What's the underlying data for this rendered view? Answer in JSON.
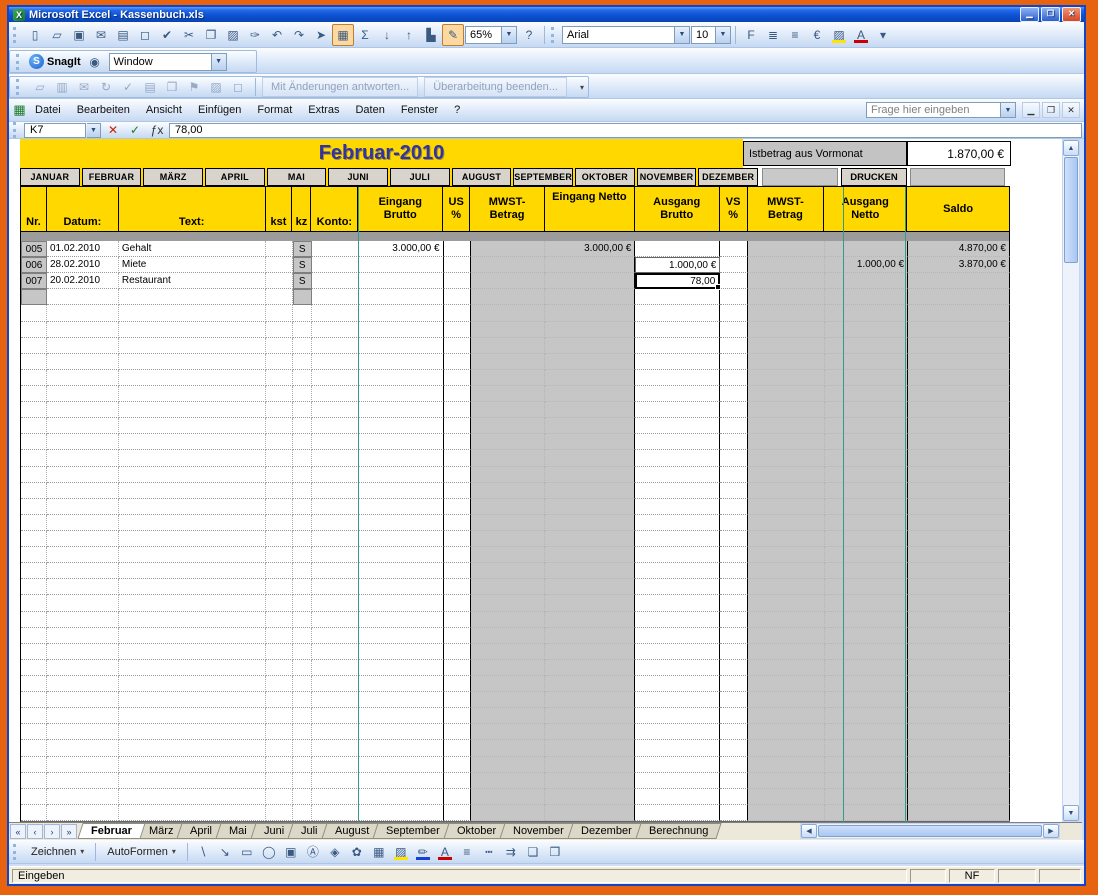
{
  "window": {
    "title": "Microsoft Excel - Kassenbuch.xls"
  },
  "window_buttons": [
    {
      "name": "minimize-button",
      "glyph": "▁"
    },
    {
      "name": "restore-button",
      "glyph": "❐"
    },
    {
      "name": "close-button",
      "glyph": "✕",
      "close": true
    }
  ],
  "standard_icons": [
    {
      "name": "new-icon",
      "glyph": "▯"
    },
    {
      "name": "open-icon",
      "glyph": "▱"
    },
    {
      "name": "save-icon",
      "glyph": "▣"
    },
    {
      "name": "mail-icon",
      "glyph": "✉"
    },
    {
      "name": "print-icon",
      "glyph": "▤"
    },
    {
      "name": "print-preview-icon",
      "glyph": "◻"
    },
    {
      "name": "spelling-icon",
      "glyph": "✔"
    },
    {
      "name": "cut-icon",
      "glyph": "✂"
    },
    {
      "name": "copy-icon",
      "glyph": "❐"
    },
    {
      "name": "paste-icon",
      "glyph": "▨"
    },
    {
      "name": "format-painter-icon",
      "glyph": "✑"
    },
    {
      "name": "undo-icon",
      "glyph": "↶"
    },
    {
      "name": "redo-icon",
      "glyph": "↷"
    },
    {
      "name": "hyperlink-icon",
      "glyph": "➤"
    },
    {
      "name": "euro-convert-icon",
      "glyph": "▦",
      "highlight": true
    },
    {
      "name": "autosum-icon",
      "glyph": "Σ"
    },
    {
      "name": "sort-ascending-icon",
      "glyph": "↓"
    },
    {
      "name": "sort-descending-icon",
      "glyph": "↑"
    },
    {
      "name": "chart-wizard-icon",
      "glyph": "▙"
    },
    {
      "name": "drawing-icon",
      "glyph": "✎",
      "highlight": true
    }
  ],
  "standard_toolbar": {
    "zoom_value": "65%"
  },
  "standard_icons_tail": [
    {
      "name": "help-icon",
      "glyph": "?"
    }
  ],
  "formatting": {
    "font_name": "Arial",
    "font_size": "10"
  },
  "formatting_icons": [
    {
      "name": "bold-icon",
      "glyph": "F"
    },
    {
      "name": "align-left-icon",
      "glyph": "≣"
    },
    {
      "name": "align-center-icon",
      "glyph": "≡"
    },
    {
      "name": "euro-style-icon",
      "glyph": "€"
    },
    {
      "name": "fill-color-icon",
      "glyph": "▨",
      "bar": "#ffe400"
    },
    {
      "name": "font-color-icon",
      "glyph": "A",
      "bar": "#cc0000"
    },
    {
      "name": "toolbar-options-icon",
      "glyph": "▾"
    }
  ],
  "snagit_toolbar": {
    "brand": "SnagIt",
    "profile": "Window"
  },
  "snagit_icons": [
    {
      "name": "capture-icon",
      "glyph": "◉"
    }
  ],
  "review_icons": [
    {
      "name": "review-tool-icon",
      "glyph": "▱",
      "disabled": true
    },
    {
      "name": "review-tool-icon",
      "glyph": "▥",
      "disabled": true
    },
    {
      "name": "review-tool-icon",
      "glyph": "✉",
      "disabled": true
    },
    {
      "name": "review-tool-icon",
      "glyph": "↻",
      "disabled": true
    },
    {
      "name": "review-tool-icon",
      "glyph": "✓",
      "disabled": true
    },
    {
      "name": "review-tool-icon",
      "glyph": "▤",
      "disabled": true
    },
    {
      "name": "review-tool-icon",
      "glyph": "❐",
      "disabled": true
    },
    {
      "name": "review-tool-icon",
      "glyph": "⚑",
      "disabled": true
    },
    {
      "name": "review-tool-icon",
      "glyph": "▨",
      "disabled": true
    },
    {
      "name": "review-tool-icon",
      "glyph": "◻",
      "disabled": true
    }
  ],
  "review_toolbar": {
    "buttons": [
      "Mit Änderungen antworten...",
      "Überarbeitung beenden..."
    ]
  },
  "menubar": {
    "items": [
      "Datei",
      "Bearbeiten",
      "Ansicht",
      "Einfügen",
      "Format",
      "Extras",
      "Daten",
      "Fenster",
      "?"
    ],
    "question_box": "Frage hier eingeben"
  },
  "workbook_window_buttons": [
    {
      "name": "minimize-window-icon",
      "glyph": "▁"
    },
    {
      "name": "restore-window-icon",
      "glyph": "❐"
    },
    {
      "name": "close-window-icon",
      "glyph": "✕"
    }
  ],
  "formula_bar": {
    "name_box": "K7",
    "input_value": "78,00"
  },
  "formula_icons": [
    {
      "name": "cancel-icon",
      "glyph": "✕",
      "color": "#cc2200"
    },
    {
      "name": "enter-icon",
      "glyph": "✓",
      "color": "#1a7a1a"
    },
    {
      "name": "insert-function-icon",
      "glyph": "ƒx",
      "color": "#333333"
    }
  ],
  "header": {
    "title": "Februar-2010",
    "carryover_label": "Istbetrag aus Vormonat",
    "carryover_value": "1.870,00 €"
  },
  "month_buttons": [
    "JANUAR",
    "FEBRUAR",
    "MÄRZ",
    "APRIL",
    "MAI",
    "JUNI",
    "JULI",
    "AUGUST",
    "SEPTEMBER",
    "OKTOBER",
    "NOVEMBER",
    "DEZEMBER"
  ],
  "print_button": "DRUCKEN",
  "table": {
    "columns": [
      "Nr.",
      "Datum:",
      "Text:",
      "kst",
      "kz",
      "Konto:",
      "Eingang\nBrutto",
      "US\n%",
      "MWST-\nBetrag",
      "Eingang Netto",
      "Ausgang\nBrutto",
      "VS\n%",
      "MWST-\nBetrag",
      "Ausgang\nNetto",
      "Saldo"
    ],
    "rows": [
      [
        "005",
        "01.02.2010",
        "Gehalt",
        "",
        "S",
        "",
        "3.000,00 €",
        "",
        "",
        "3.000,00 €",
        "",
        "",
        "",
        "",
        "4.870,00 €"
      ],
      [
        "006",
        "28.02.2010",
        "Miete",
        "",
        "S",
        "",
        "",
        "",
        "",
        "",
        "1.000,00 €",
        "",
        "",
        "1.000,00 €",
        "3.870,00 €"
      ],
      [
        "007",
        "20.02.2010",
        "Restaurant",
        "",
        "S",
        "",
        "",
        "",
        "",
        "",
        "78,00",
        "",
        "",
        "",
        ""
      ]
    ],
    "selected_cell": {
      "ref": "K7",
      "row": 2,
      "col": 10
    },
    "boxed_cell": {
      "row": 1,
      "col": 10
    }
  },
  "sheet_tabs": [
    "Februar",
    "März",
    "April",
    "Mai",
    "Juni",
    "Juli",
    "August",
    "September",
    "Oktober",
    "November",
    "Dezember",
    "Berechnung"
  ],
  "active_tab": "Februar",
  "tabnav_icons": [
    {
      "name": "first-sheet-icon",
      "glyph": "«"
    },
    {
      "name": "previous-sheet-icon",
      "glyph": "‹"
    },
    {
      "name": "next-sheet-icon",
      "glyph": "›"
    },
    {
      "name": "last-sheet-icon",
      "glyph": "»"
    }
  ],
  "drawing_toolbar": {
    "draw_menu": "Zeichnen",
    "autoshapes_menu": "AutoFormen"
  },
  "drawing_icons": [
    {
      "name": "line-icon",
      "glyph": "∖"
    },
    {
      "name": "arrow-icon",
      "glyph": "↘"
    },
    {
      "name": "rectangle-icon",
      "glyph": "▭"
    },
    {
      "name": "oval-icon",
      "glyph": "◯"
    },
    {
      "name": "textbox-icon",
      "glyph": "▣"
    },
    {
      "name": "wordart-icon",
      "glyph": "Ⓐ"
    },
    {
      "name": "diagram-icon",
      "glyph": "◈"
    },
    {
      "name": "clipart-icon",
      "glyph": "✿"
    },
    {
      "name": "picture-icon",
      "glyph": "▦"
    },
    {
      "name": "fill-color-icon",
      "glyph": "▨",
      "bar": "#ffe400"
    },
    {
      "name": "line-color-icon",
      "glyph": "✏",
      "bar": "#1240d8"
    },
    {
      "name": "font-color-icon",
      "glyph": "A",
      "bar": "#cc0000"
    },
    {
      "name": "line-style-icon",
      "glyph": "≡"
    },
    {
      "name": "dash-style-icon",
      "glyph": "┅"
    },
    {
      "name": "arrow-style-icon",
      "glyph": "⇉"
    },
    {
      "name": "shadow-style-icon",
      "glyph": "❏"
    },
    {
      "name": "3d-style-icon",
      "glyph": "❒"
    }
  ],
  "status_bar": {
    "mode": "Eingeben",
    "numlock": "NF"
  },
  "colors": {
    "frame_orange": "#e8630f",
    "titlebar_blue": "#0c50d2",
    "accent_gold": "#ffd800",
    "title_text": "#3333a0",
    "gray_fill": "#c6c6c6",
    "teal_line": "#2e9c86"
  }
}
